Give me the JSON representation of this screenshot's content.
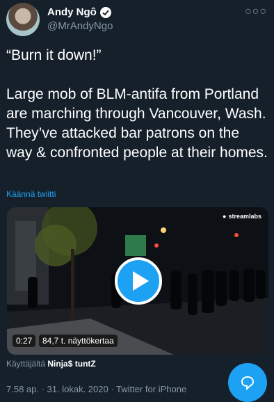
{
  "author": {
    "name": "Andy Ngô",
    "handle": "@MrAndyNgo"
  },
  "tweet": {
    "text": "“Burn it down!”\n\nLarge mob of BLM-antifa from Portland are marching through Vancouver, Wash. They’ve attacked bar patrons on the way & confronted people at their homes.",
    "translate_label": "Käännä twiitti"
  },
  "video": {
    "watermark": "streamlabs",
    "duration": "0:27",
    "views": "84,7 t. näyttökertaa"
  },
  "attribution": {
    "prefix": "Käyttäjältä",
    "user": "Ninja$ tuntZ"
  },
  "meta": {
    "timestamp": "7.58 ap. · 31. lokak. 2020 · Twitter for iPhone"
  },
  "colors": {
    "background": "#15202b",
    "accent": "#1da1f2",
    "secondary_text": "#8899a6"
  },
  "icons": {
    "verified": "verified-badge-icon",
    "more": "more-options-icon",
    "play": "play-icon",
    "reply": "reply-fab-icon"
  }
}
